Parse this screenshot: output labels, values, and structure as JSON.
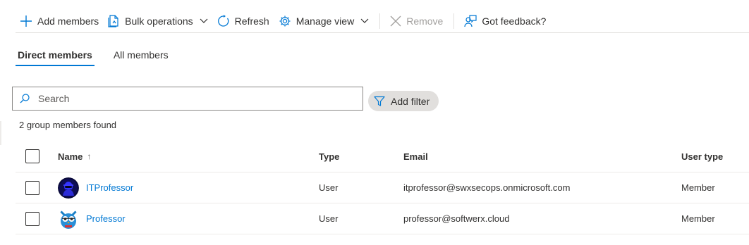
{
  "toolbar": {
    "add_members": "Add members",
    "bulk_operations": "Bulk operations",
    "refresh": "Refresh",
    "manage_view": "Manage view",
    "remove": "Remove",
    "feedback": "Got feedback?"
  },
  "tabs": [
    {
      "label": "Direct members",
      "active": true
    },
    {
      "label": "All members",
      "active": false
    }
  ],
  "search": {
    "placeholder": "Search",
    "value": ""
  },
  "filter": {
    "label": "Add filter"
  },
  "result_count": "2 group members found",
  "table": {
    "columns": {
      "name": "Name",
      "sort_arrow": "↑",
      "type": "Type",
      "email": "Email",
      "user_type": "User type"
    },
    "rows": [
      {
        "name": "ITProfessor",
        "type": "User",
        "email": "itprofessor@swxsecops.onmicrosoft.com",
        "user_type": "Member",
        "avatar": "hooded-figure-avatar-icon"
      },
      {
        "name": "Professor",
        "type": "User",
        "email": "professor@softwerx.cloud",
        "user_type": "Member",
        "avatar": "owl-avatar-icon"
      }
    ]
  },
  "colors": {
    "accent": "#0078d4",
    "text": "#323130",
    "disabled": "#a19f9d",
    "border": "#edebe9"
  }
}
